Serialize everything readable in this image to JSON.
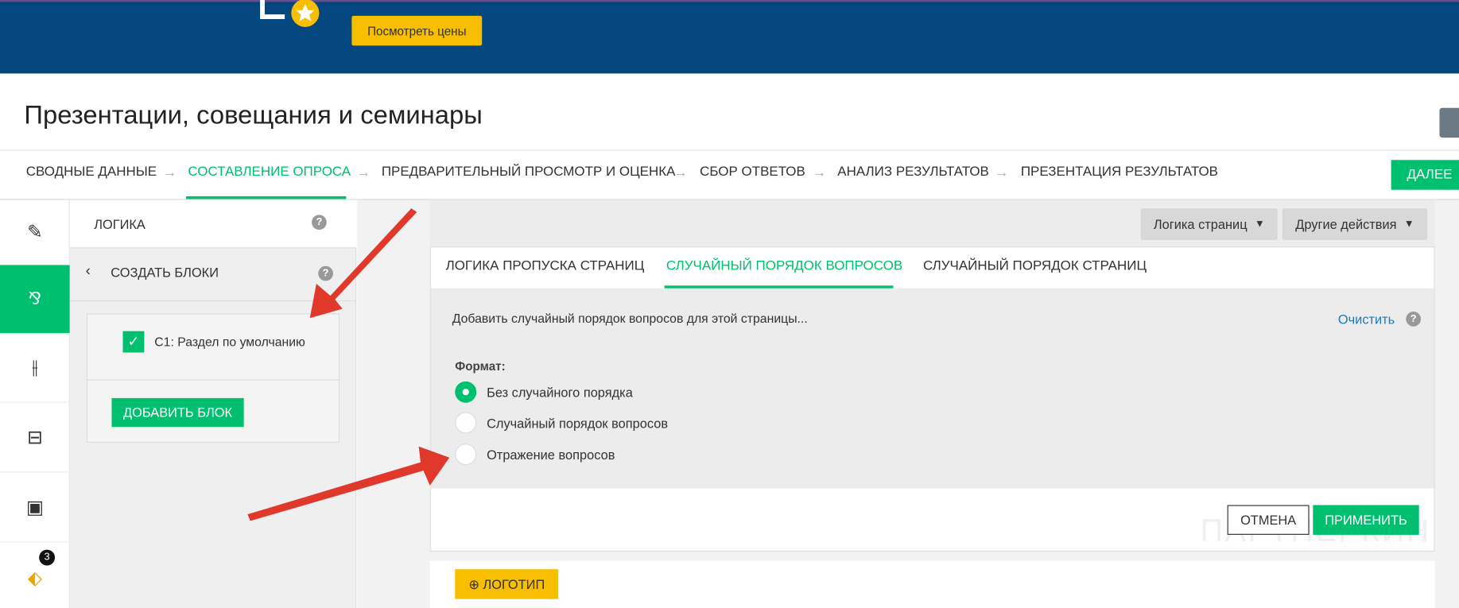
{
  "banner": {
    "view_prices": "Посмотреть цены"
  },
  "page_title": "Презентации, совещания и семинары",
  "steps": [
    {
      "label": "СВОДНЫЕ ДАННЫЕ"
    },
    {
      "label": "СОСТАВЛЕНИЕ ОПРОСА",
      "active": true
    },
    {
      "label": "ПРЕДВАРИТЕЛЬНЫЙ ПРОСМОТР И ОЦЕНКА"
    },
    {
      "label": "СБОР ОТВЕТОВ"
    },
    {
      "label": "АНАЛИЗ РЕЗУЛЬТАТОВ"
    },
    {
      "label": "ПРЕЗЕНТАЦИЯ РЕЗУЛЬТАТОВ"
    }
  ],
  "next_label": "ДАЛЕЕ",
  "rail": {
    "badge_count": "3",
    "icons": [
      "brush-icon",
      "logic-icon",
      "sliders-icon",
      "inbox-icon",
      "layout-icon",
      "tag-icon"
    ]
  },
  "side": {
    "header": "ЛОГИКА",
    "subheader": "СОЗДАТЬ БЛОКИ",
    "block_label": "С1: Раздел по умолчанию",
    "add_block": "ДОБАВИТЬ БЛОК",
    "help": "?"
  },
  "toolbar": {
    "page_logic": "Логика страниц",
    "other_actions": "Другие действия"
  },
  "tabs": [
    {
      "label": "ЛОГИКА ПРОПУСКА СТРАНИЦ"
    },
    {
      "label": "СЛУЧАЙНЫЙ ПОРЯДОК ВОПРОСОВ",
      "active": true
    },
    {
      "label": "СЛУЧАЙНЫЙ ПОРЯДОК СТРАНИЦ"
    }
  ],
  "panel": {
    "description": "Добавить случайный порядок вопросов для этой страницы...",
    "clear": "Очистить",
    "format_label": "Формат:",
    "options": [
      {
        "label": "Без случайного порядка",
        "selected": true
      },
      {
        "label": "Случайный порядок вопросов",
        "selected": false
      },
      {
        "label": "Отражение вопросов",
        "selected": false
      }
    ],
    "cancel": "ОТМЕНА",
    "apply": "ПРИМЕНИТЬ"
  },
  "logo_button": "ЛОГОТИП",
  "watermark": "ПАРТНЕРКИН",
  "colors": {
    "brand_green": "#00bf6f",
    "banner_blue": "#04477f",
    "yellow": "#f7bf00",
    "arrow_red": "#e0392b"
  }
}
